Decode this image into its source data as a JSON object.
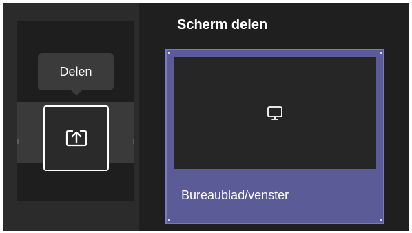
{
  "tooltip": {
    "text": "Delen"
  },
  "share_button": {
    "icon": "share-screen-icon"
  },
  "share_panel": {
    "title": "Scherm delen",
    "options": [
      {
        "label": "Bureaublad/venster",
        "icon": "monitor-icon"
      }
    ]
  },
  "colors": {
    "accent": "#5b5b98",
    "background": "#1f1f1f",
    "toolbar": "#1e1e1e"
  }
}
